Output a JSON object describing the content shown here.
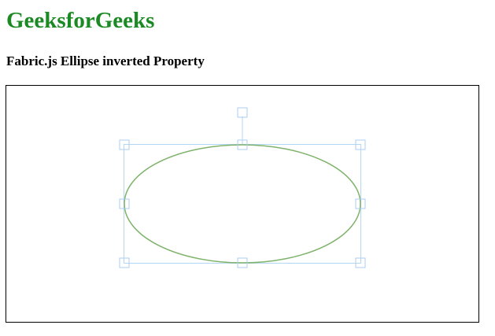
{
  "page": {
    "title": "GeeksforGeeks",
    "subtitle": "Fabric.js Ellipse inverted Property"
  },
  "canvas": {
    "object": {
      "type": "ellipse",
      "stroke_color": "#7fb36b",
      "fill": "none",
      "selected": true,
      "inverted": true
    },
    "selection": {
      "border_color": "#b3d6f5",
      "control_color": "#a9cdf0",
      "controls": [
        "top-left",
        "top-middle",
        "top-right",
        "middle-left",
        "middle-right",
        "bottom-left",
        "bottom-middle",
        "bottom-right",
        "rotate"
      ]
    }
  }
}
